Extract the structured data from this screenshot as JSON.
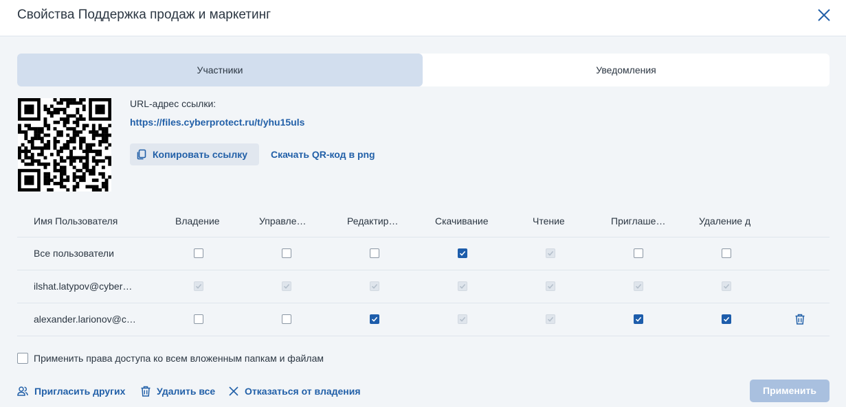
{
  "dialog": {
    "title": "Свойства Поддержка продаж и маркетинг"
  },
  "tabs": [
    {
      "label": "Участники",
      "active": true
    },
    {
      "label": "Уведомления",
      "active": false
    }
  ],
  "share": {
    "url_label": "URL-адрес ссылки:",
    "url": "https://files.cyberprotect.ru/t/yhu15uls",
    "copy_label": "Копировать ссылку",
    "download_qr_label": "Скачать QR-код в png"
  },
  "table": {
    "columns": [
      "Имя Пользователя",
      "Владение",
      "Управле…",
      "Редактир…",
      "Скачивание",
      "Чтение",
      "Приглашение",
      "Удаление д"
    ],
    "rows": [
      {
        "user": "Все пользователи",
        "perms": [
          "unchecked",
          "unchecked",
          "unchecked",
          "checked",
          "disabled",
          "unchecked",
          "unchecked"
        ],
        "deletable": false
      },
      {
        "user": "ilshat.latypov@cyber…",
        "perms": [
          "disabled",
          "disabled",
          "disabled",
          "disabled",
          "disabled",
          "disabled",
          "disabled"
        ],
        "deletable": false
      },
      {
        "user": "alexander.larionov@c…",
        "perms": [
          "unchecked",
          "unchecked",
          "checked",
          "disabled",
          "disabled",
          "checked",
          "checked"
        ],
        "deletable": true
      }
    ]
  },
  "apply_recursive_label": "Применить права доступа ко всем вложенным папкам и файлам",
  "actions": {
    "invite_label": "Пригласить других",
    "delete_all_label": "Удалить все",
    "renounce_label": "Отказаться от владения"
  },
  "apply_button_label": "Применить",
  "icons": {
    "close": "close-icon",
    "copy": "copy-icon",
    "trash": "trash-icon",
    "invite": "users-icon"
  },
  "colors": {
    "accent": "#2260a8",
    "checkbox_checked": "#1d5dab",
    "tab_active": "#d2deee",
    "apply_disabled": "#a9c0df"
  }
}
